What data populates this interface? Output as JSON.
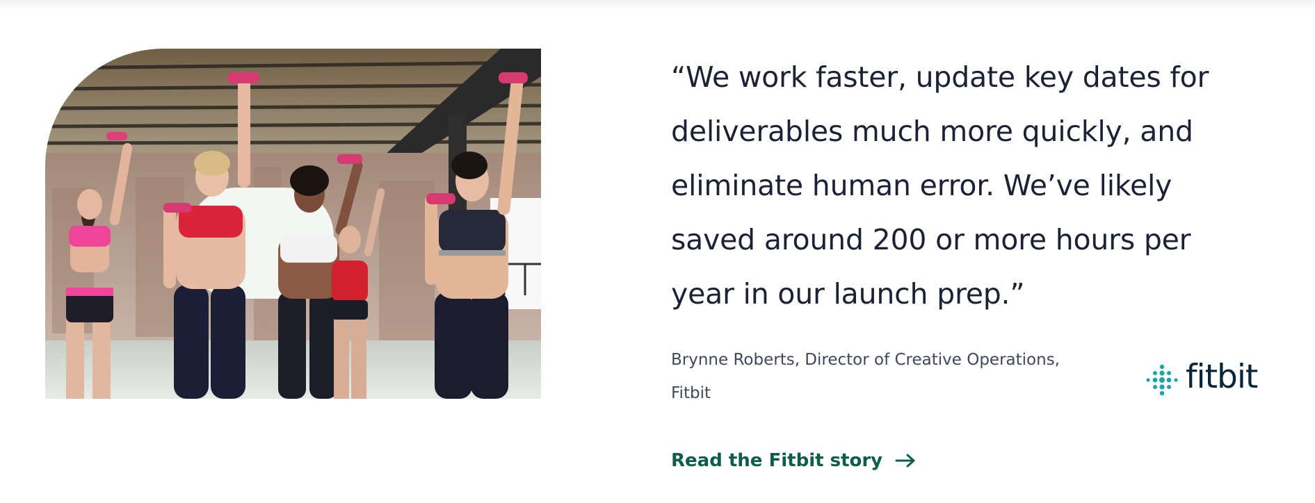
{
  "testimonial": {
    "quote": "“We work faster, update key dates for deliverables much more quickly, and eliminate human error. We’ve likely saved around 200 or more hours per year in our launch prep.”",
    "attribution": "Brynne Roberts, Director of Creative Operations, Fitbit",
    "brand_logo": "fitbit",
    "link_label": "Read the Fitbit story",
    "link_icon": "arrow-right-icon"
  },
  "photo": {
    "subject": "women-lifting-dumbbells-photo"
  },
  "colors": {
    "quote_text": "#1c2236",
    "attribution_text": "#414758",
    "link": "#0c5e48",
    "logo_dots": "#1ba6a6",
    "logo_text": "#07263a"
  }
}
